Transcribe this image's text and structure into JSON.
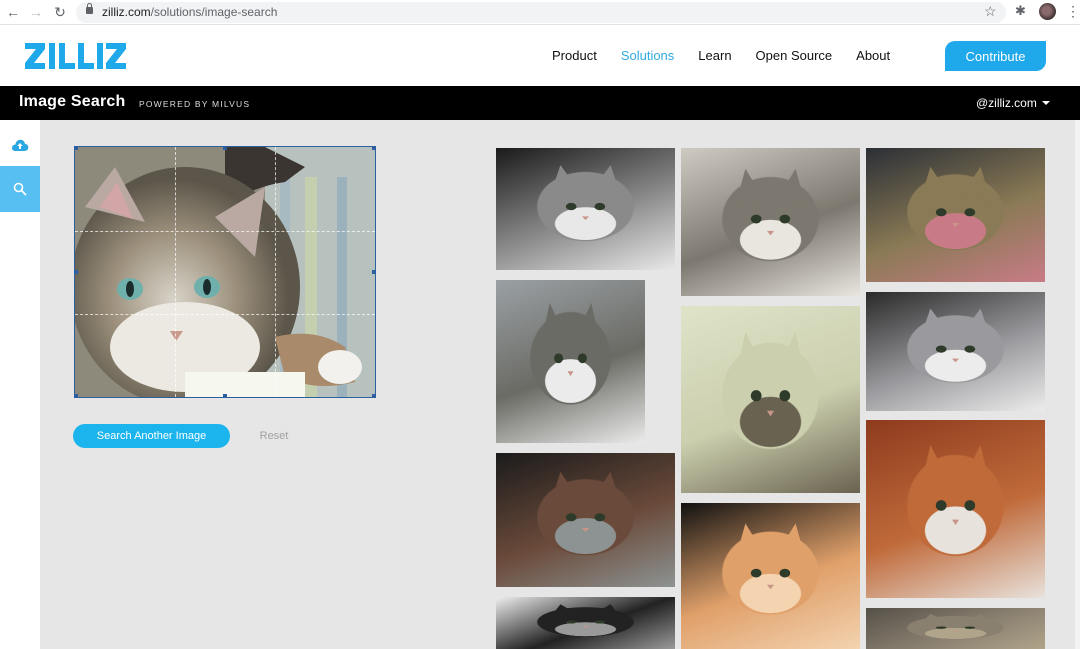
{
  "browser": {
    "url_host": "zilliz.com",
    "url_path": "/solutions/image-search",
    "back_icon": "arrow-left-icon",
    "forward_icon": "arrow-right-icon",
    "reload_icon": "reload-icon",
    "bookmark_icon": "star-icon",
    "extensions_icon": "puzzle-icon",
    "menu_icon": "kebab-menu-icon"
  },
  "header": {
    "logo_text": "ZILLIZ",
    "nav": [
      {
        "label": "Product",
        "active": false
      },
      {
        "label": "Solutions",
        "active": true
      },
      {
        "label": "Learn",
        "active": false
      },
      {
        "label": "Open Source",
        "active": false
      },
      {
        "label": "About",
        "active": false
      }
    ],
    "cta_label": "Contribute",
    "accent_color": "#1fa8ea"
  },
  "subheader": {
    "title": "Image Search",
    "powered_by": "POWERED BY MILVUS",
    "account": "@zilliz.com"
  },
  "rail": {
    "items": [
      {
        "name": "upload",
        "icon": "cloud-upload-icon",
        "active": false
      },
      {
        "name": "search",
        "icon": "search-icon",
        "active": true
      }
    ]
  },
  "query": {
    "image_description": "Tabby cat with white chest and green eyes, cropped selection with rule-of-thirds grid",
    "search_another_label": "Search Another Image",
    "reset_label": "Reset"
  },
  "results": [
    {
      "description": "Black and white photo of a tabby cat resting",
      "palette": [
        "#1a1a1a",
        "#8a8a8a",
        "#e8e8e8"
      ]
    },
    {
      "description": "Tabby kitten with white face lying in a box",
      "palette": [
        "#cfcac2",
        "#7d786f",
        "#e9e6e0"
      ]
    },
    {
      "description": "Tabby cat with green eyes in a cage",
      "palette": [
        "#2b2f36",
        "#8a7a55",
        "#c87b86"
      ]
    },
    {
      "description": "Tabby and white kitten sitting in metal cage",
      "palette": [
        "#9aa0a4",
        "#6b6b65",
        "#ebebeb"
      ]
    },
    {
      "description": "White cat with tabby head lying on floor",
      "palette": [
        "#dfe3c8",
        "#cbcfae",
        "#6a6250"
      ]
    },
    {
      "description": "Three grey kittens huddled together",
      "palette": [
        "#2a2a2a",
        "#9a9a9e",
        "#ececec"
      ]
    },
    {
      "description": "Black and white tuxedo kitten",
      "palette": [
        "#1b1b1b",
        "#6a4a3a",
        "#8d9392"
      ]
    },
    {
      "description": "Orange tabby cat close-up on black background",
      "palette": [
        "#111111",
        "#e0a06a",
        "#f3d3b0"
      ]
    },
    {
      "description": "Calico cat crouching on rust colored fabric",
      "palette": [
        "#8e3b1e",
        "#c06a3a",
        "#e8e2dc"
      ]
    },
    {
      "description": "Black and white cat on white surface",
      "palette": [
        "#eeeeee",
        "#222222",
        "#9a9a9a"
      ]
    },
    {
      "description": "Grey tabby cat partially visible",
      "palette": [
        "#555048",
        "#8a8070",
        "#b0a48a"
      ]
    }
  ]
}
